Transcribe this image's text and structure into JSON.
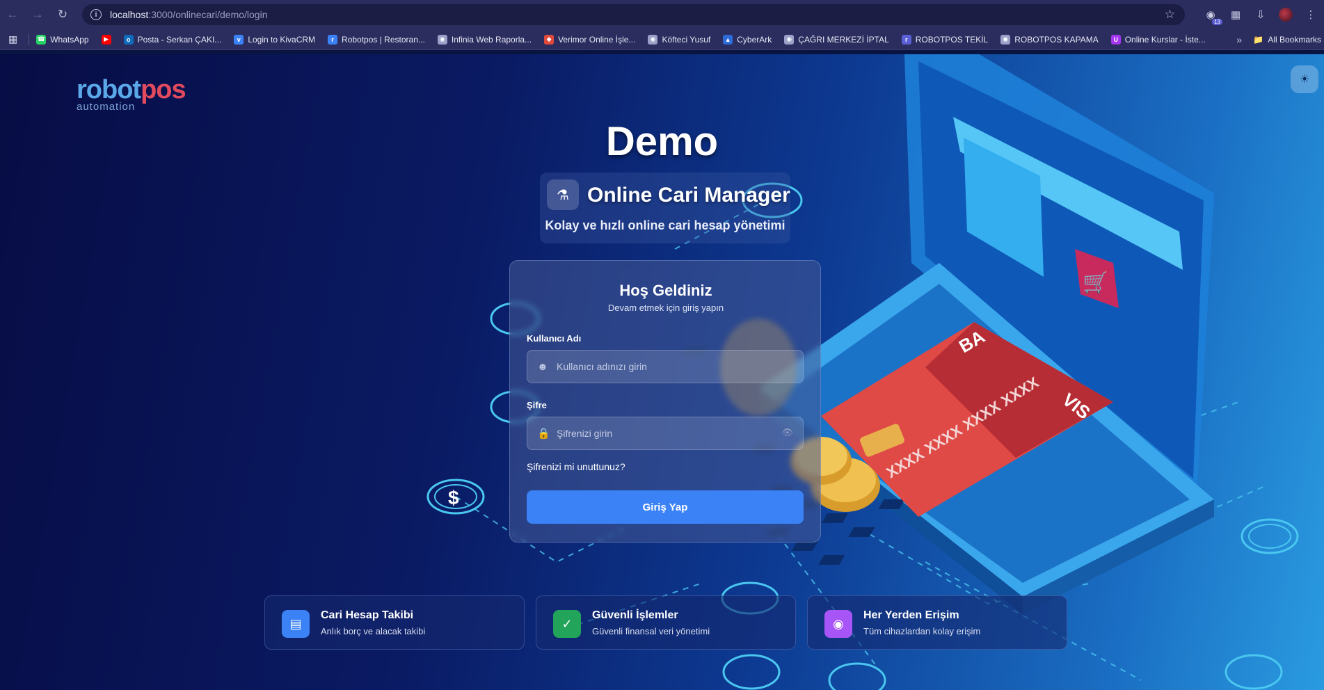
{
  "browser": {
    "url_host": "localhost",
    "url_path": ":3000/onlinecari/demo/login",
    "extension_badge": "13"
  },
  "bookmarks": [
    {
      "label": "WhatsApp",
      "icon": "whatsapp-icon",
      "color": "#25d366"
    },
    {
      "label": "",
      "icon": "youtube-icon",
      "color": "#ff0000"
    },
    {
      "label": "Posta - Serkan ÇAKI...",
      "icon": "outlook-icon",
      "color": "#0f6cbd"
    },
    {
      "label": "Login to KivaCRM",
      "icon": "kiva-icon",
      "color": "#3b82f6"
    },
    {
      "label": "Robotpos | Restoran...",
      "icon": "robotpos-icon",
      "color": "#3b82f6"
    },
    {
      "label": "Infinia Web Raporla...",
      "icon": "globe-icon",
      "color": "#9aa0c8"
    },
    {
      "label": "Verimor Online İşle...",
      "icon": "verimor-icon",
      "color": "#e24a3b"
    },
    {
      "label": "Köfteci Yusuf",
      "icon": "globe-icon",
      "color": "#9aa0c8"
    },
    {
      "label": "CyberArk",
      "icon": "cyberark-icon",
      "color": "#2d6bd8"
    },
    {
      "label": "ÇAĞRI MERKEZİ İPTAL",
      "icon": "globe-icon",
      "color": "#9aa0c8"
    },
    {
      "label": "ROBOTPOS TEKİL",
      "icon": "robotpos-icon",
      "color": "#5b5fd6"
    },
    {
      "label": "ROBOTPOS KAPAMA",
      "icon": "globe-icon",
      "color": "#9aa0c8"
    },
    {
      "label": "Online Kurslar - İste...",
      "icon": "udemy-icon",
      "color": "#a435f0"
    }
  ],
  "all_bookmarks": "All Bookmarks",
  "brand": {
    "part1": "robot",
    "part2": "pos",
    "sub": "automation"
  },
  "hero": {
    "title": "Demo",
    "app_name": "Online Cari Manager",
    "tagline": "Kolay ve hızlı online cari hesap yönetimi"
  },
  "login": {
    "title": "Hoş Geldiniz",
    "subtitle": "Devam etmek için giriş yapın",
    "username_label": "Kullanıcı Adı",
    "username_placeholder": "Kullanıcı adınızı girin",
    "password_label": "Şifre",
    "password_placeholder": "Şifrenizi girin",
    "forgot": "Şifrenizi mi unuttunuz?",
    "submit": "Giriş Yap"
  },
  "features": [
    {
      "title": "Cari Hesap Takibi",
      "desc": "Anlık borç ve alacak takibi",
      "icon": "bar-chart-icon",
      "color": "#3b82f6"
    },
    {
      "title": "Güvenli İşlemler",
      "desc": "Güvenli finansal veri yönetimi",
      "icon": "shield-check-icon",
      "color": "#22a55a"
    },
    {
      "title": "Her Yerden Erişim",
      "desc": "Tüm cihazlardan kolay erişim",
      "icon": "globe-icon",
      "color": "#a855f7"
    }
  ]
}
